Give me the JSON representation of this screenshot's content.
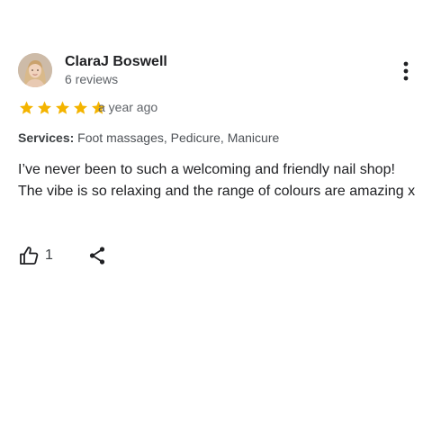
{
  "review": {
    "author": {
      "name": "ClaraJ Boswell",
      "review_count": "6 reviews",
      "avatar_icon": "user-avatar-photo"
    },
    "rating": {
      "stars": 5,
      "max_stars": 5,
      "star_color": "#f4b400"
    },
    "date": "a year ago",
    "services": {
      "label": "Services:",
      "value": "Foot massages, Pedicure, Manicure"
    },
    "text": "I’ve never been to such a welcoming and friendly nail shop! The vibe is so relaxing and the range of colours are amazing x",
    "actions": {
      "like_icon": "thumbs-up-icon",
      "like_count": "1",
      "share_icon": "share-icon",
      "more_icon": "more-vert-icon"
    }
  }
}
